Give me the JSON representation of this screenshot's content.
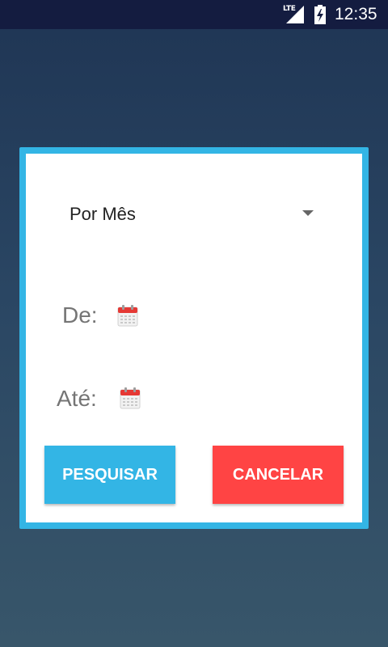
{
  "status_bar": {
    "network": "LTE",
    "time": "12:35",
    "icons": [
      "lte-icon",
      "signal-icon",
      "battery-charging-icon"
    ]
  },
  "dialog": {
    "accent_color": "#33b5e5",
    "period_selector": {
      "selected": "Por Mês"
    },
    "from_label": "De:",
    "to_label": "Até:",
    "search_button": "PESQUISAR",
    "cancel_button": "CANCELAR",
    "search_color": "#33b5e5",
    "cancel_color": "#ff4444"
  }
}
